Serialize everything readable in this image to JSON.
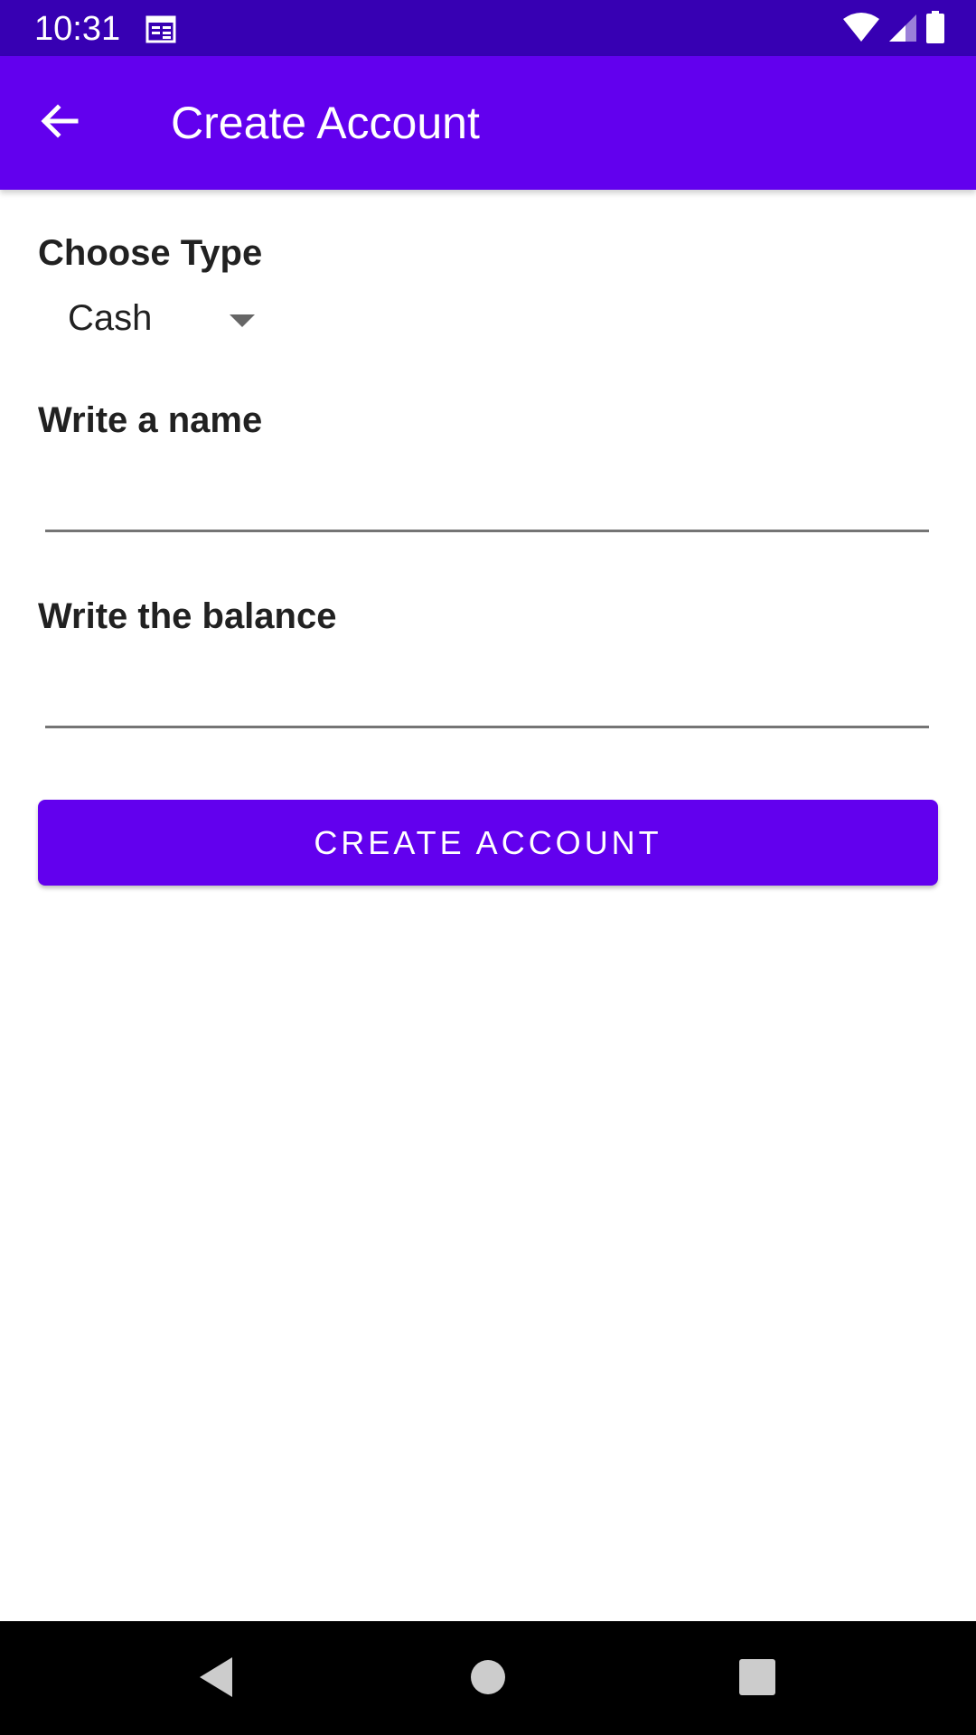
{
  "status_bar": {
    "time": "10:31",
    "icons": [
      "calendar-icon",
      "wifi-icon",
      "signal-icon",
      "battery-icon"
    ],
    "background": "#3700b3"
  },
  "app_bar": {
    "title": "Create Account",
    "back_icon": "arrow-back-icon",
    "background": "#6200ee"
  },
  "form": {
    "type_label": "Choose Type",
    "type_value": "Cash",
    "name_label": "Write a name",
    "name_value": "",
    "balance_label": "Write the balance",
    "balance_value": "",
    "submit_label": "CREATE ACCOUNT"
  },
  "nav_bar": {
    "icons": [
      "nav-back-icon",
      "nav-home-icon",
      "nav-recents-icon"
    ]
  },
  "colors": {
    "primary": "#6200ee",
    "primary_dark": "#3700b3",
    "text": "#212121"
  }
}
